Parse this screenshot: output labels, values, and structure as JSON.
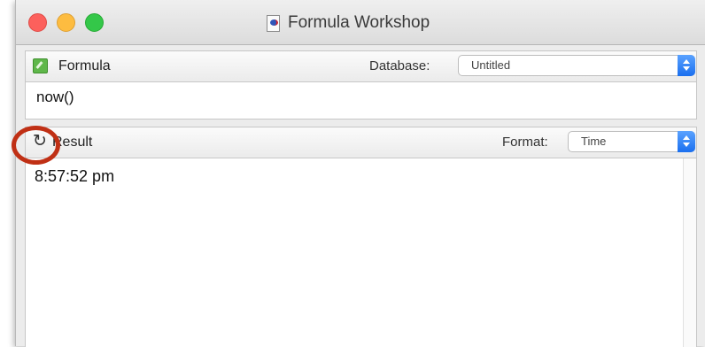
{
  "window": {
    "title": "Formula Workshop"
  },
  "formula_panel": {
    "header_label": "Formula",
    "database_label": "Database:",
    "database_value": "Untitled",
    "formula_text": "now()"
  },
  "result_panel": {
    "header_label": "Result",
    "format_label": "Format:",
    "format_value": "Time",
    "result_text": "8:57:52 pm"
  },
  "icons": {
    "close": "close-button",
    "minimize": "minimize-button",
    "zoom": "zoom-button",
    "document": "document-icon",
    "formula": "formula-icon",
    "refresh": "refresh-icon"
  },
  "colors": {
    "close": "#fc605c",
    "minimize": "#fdbc40",
    "zoom": "#34c749",
    "stepper": "#1a6fef",
    "annotation": "#c03015"
  }
}
